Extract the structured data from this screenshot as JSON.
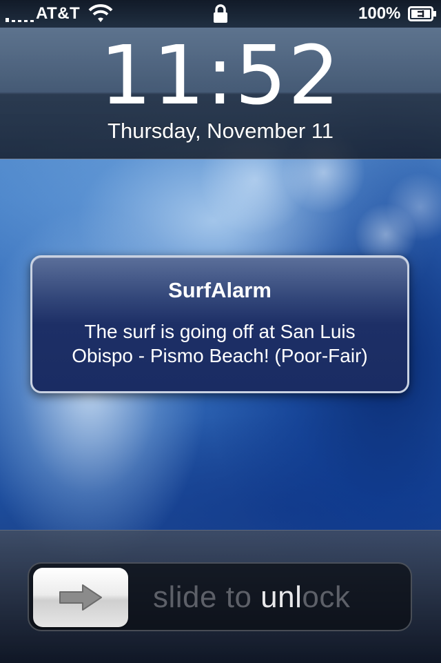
{
  "status_bar": {
    "carrier": "AT&T",
    "battery_percent": "100%",
    "signal_icon": "signal-dots-icon",
    "wifi_icon": "wifi-icon",
    "lock_icon": "lock-icon",
    "battery_icon": "battery-charging-icon"
  },
  "lock_screen": {
    "time": "11:52",
    "date": "Thursday, November 11"
  },
  "notification": {
    "app": "SurfAlarm",
    "line1": "The surf is going off at San Luis",
    "line2": "Obispo - Pismo Beach! (Poor-Fair)"
  },
  "unlock": {
    "label_pre": "slide to ",
    "label_highlight": "unl",
    "label_post": "ock",
    "arrow_icon": "right-arrow-icon"
  },
  "colors": {
    "notification_bg": "#1d2f66",
    "notification_border": "#c9d2e2",
    "text": "#ffffff"
  }
}
